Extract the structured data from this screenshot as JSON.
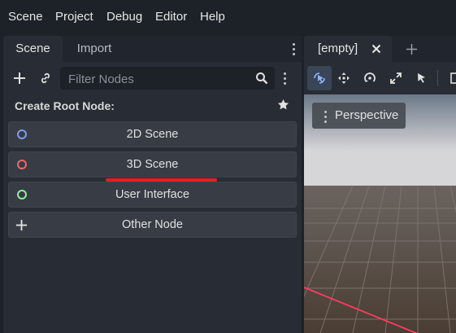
{
  "menubar": {
    "items": [
      "Scene",
      "Project",
      "Debug",
      "Editor",
      "Help"
    ]
  },
  "scene_dock": {
    "tabs": [
      {
        "label": "Scene",
        "active": true
      },
      {
        "label": "Import",
        "active": false
      }
    ],
    "toolbar": {
      "add_icon": "plus-icon",
      "link_icon": "link-icon",
      "filter": {
        "placeholder": "Filter Nodes",
        "value": ""
      },
      "search_icon": "search-icon",
      "menu_icon": "kebab-menu-icon"
    },
    "create_root_title": "Create Root Node:",
    "favorite_icon": "star-icon",
    "root_buttons": [
      {
        "label": "2D Scene",
        "icon": "node2d-icon",
        "icon_color": "#7e9cf0"
      },
      {
        "label": "3D Scene",
        "icon": "node3d-icon",
        "icon_color": "#f06868"
      },
      {
        "label": "User Interface",
        "icon": "control-icon",
        "icon_color": "#8eef97"
      },
      {
        "label": "Other Node",
        "icon": "plus-icon",
        "icon_color": "#e0e0e0"
      }
    ],
    "highlight_color": "#e32020"
  },
  "editor": {
    "document_tab": {
      "label": "[empty]",
      "close_icon": "close-icon"
    },
    "new_tab_icon": "plus-icon",
    "viewport_tools": [
      "select-mode-icon",
      "move-mode-icon",
      "rotate-mode-icon",
      "scale-mode-icon",
      "list-select-icon"
    ],
    "viewport": {
      "perspective_label": "Perspective"
    }
  },
  "colors": {
    "background": "#1d2229",
    "panel": "#282c34",
    "button": "#373c45",
    "accent": "#8eb4f6"
  }
}
